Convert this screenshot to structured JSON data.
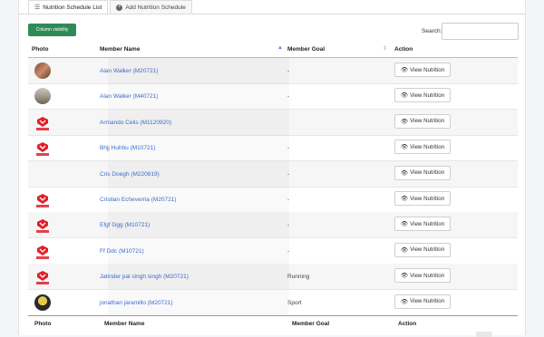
{
  "tabs": [
    {
      "label": "Nutrition Schedule List",
      "icon": "list-icon",
      "active": true
    },
    {
      "label": "Add Nutrition Schedule",
      "icon": "plus-circle-icon",
      "active": false
    }
  ],
  "toolbar": {
    "column_visibility_label": "Column visibility",
    "search_label": "Search:",
    "search_value": ""
  },
  "table": {
    "headers": {
      "photo": "Photo",
      "member_name": "Member Name",
      "member_goal": "Member Goal",
      "action": "Action"
    },
    "footers": {
      "photo": "Photo",
      "member_name": "Member Name",
      "member_goal": "Member Goal",
      "action": "Action"
    },
    "rows": [
      {
        "photo": "avatar-photo",
        "name": "Alan Walker (M20721)",
        "goal": "-",
        "action": "View Nutrition"
      },
      {
        "photo": "avatar-photo",
        "name": "Alan Walker (M40721)",
        "goal": "-",
        "action": "View Nutrition"
      },
      {
        "photo": "gym-logo",
        "name": "Armando Celis (M1120920)",
        "goal": "",
        "action": "View Nutrition"
      },
      {
        "photo": "gym-logo",
        "name": "Bhjj Huhhu (M10721)",
        "goal": "-",
        "action": "View Nutrition"
      },
      {
        "photo": "blank",
        "name": "Cris Doegh (M220819)",
        "goal": "-",
        "action": "View Nutrition"
      },
      {
        "photo": "gym-logo",
        "name": "Cristian Echeverria (M20721)",
        "goal": "-",
        "action": "View Nutrition"
      },
      {
        "photo": "gym-logo",
        "name": "Efgf Ggg (M10721)",
        "goal": "-",
        "action": "View Nutrition"
      },
      {
        "photo": "gym-logo",
        "name": "Ff Ddc (M10721)",
        "goal": "-",
        "action": "View Nutrition"
      },
      {
        "photo": "gym-logo",
        "name": "Jatinder pal singh singh (M20721)",
        "goal": "Running",
        "action": "View Nutrition"
      },
      {
        "photo": "avatar-photo-dark",
        "name": "jonathan jaramillo (M20721)",
        "goal": "Sport",
        "action": "View Nutrition"
      }
    ]
  },
  "colors": {
    "accent_green": "#2e8b57",
    "link_blue": "#3b6cc9",
    "logo_red": "#e0202a"
  }
}
